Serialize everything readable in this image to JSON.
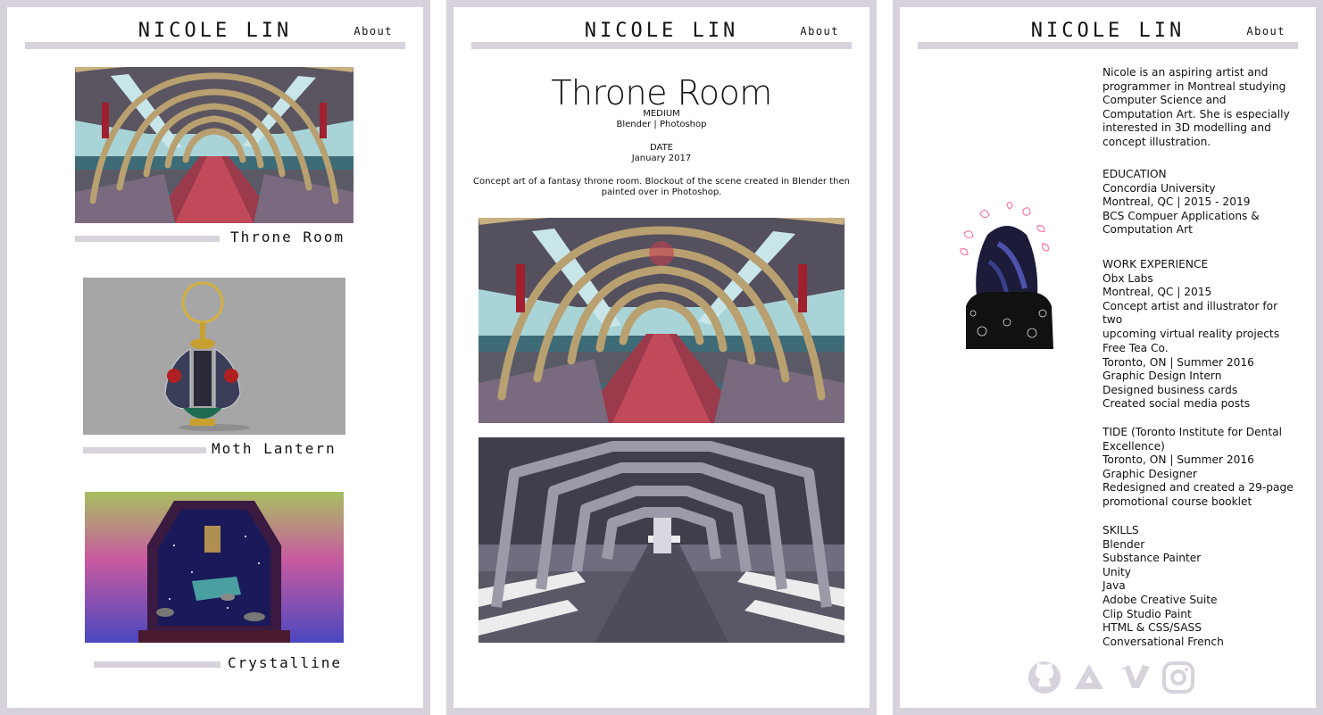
{
  "site": {
    "title": "NICOLE LIN",
    "about_label": "About"
  },
  "gallery": {
    "items": [
      {
        "label": "Throne Room"
      },
      {
        "label": "Moth Lantern"
      },
      {
        "label": "Crystalline"
      }
    ]
  },
  "project": {
    "title": "Throne Room",
    "medium_heading": "MEDIUM",
    "medium_value": "Blender | Photoshop",
    "date_heading": "DATE",
    "date_value": "January 2017",
    "description_line1": "Concept art of a fantasy throne room. Blockout of the scene created in Blender then",
    "description_line2": "painted over in Photoshop."
  },
  "about": {
    "intro": "Nicole is an aspiring artist and programmer in Montreal studying Computer Science and Computation Art. She is especially interested in 3D modelling and concept illustration.",
    "education_heading": "EDUCATION",
    "education": [
      "Concordia University",
      "Montreal, QC | 2015 - 2019",
      "BCS Compuer Applications &",
      "Computation Art"
    ],
    "work_heading": "WORK EXPERIENCE",
    "work1": [
      "Obx Labs",
      "Montreal, QC | 2015",
      "Concept artist and illustrator for two",
      "upcoming virtual reality projects"
    ],
    "work2": [
      "Free Tea Co.",
      "Toronto, ON | Summer 2016",
      "Graphic Design Intern",
      "Designed business cards",
      "Created social media posts"
    ],
    "work3": [
      "TIDE (Toronto Institute for Dental",
      "Excellence)",
      "Toronto, ON | Summer 2016",
      "Graphic Designer",
      "Redesigned and created a 29-page",
      "promotional course booklet"
    ],
    "skills_heading": "SKILLS",
    "skills": [
      "Blender",
      "Substance Painter",
      "Unity",
      "Java",
      "Adobe Creative Suite",
      "Clip Studio Paint",
      "HTML & CSS/SASS",
      "Conversational French"
    ]
  },
  "social": {
    "icons": [
      "github-icon",
      "artstation-icon",
      "vimeo-icon",
      "instagram-icon"
    ]
  },
  "colors": {
    "frame": "#d8d2dc",
    "icon": "#d8d2dc"
  }
}
